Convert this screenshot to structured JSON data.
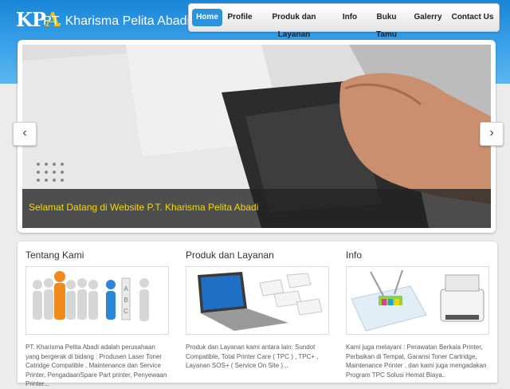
{
  "site": {
    "logo_mark": "KP",
    "logo_mark_accent": "A",
    "title": "PT. Kharisma Pelita Abadi"
  },
  "nav": {
    "items": [
      "Home",
      "Profile",
      "Produk dan Layanan",
      "Info",
      "Buku Tamu",
      "Galerry",
      "Contact Us"
    ],
    "active": "Home"
  },
  "slider": {
    "caption": "Selamat Datang di Website P.T. Kharisma Pelita Abadi",
    "prev_glyph": "‹",
    "next_glyph": "›"
  },
  "panels": [
    {
      "title": "Tentang Kami",
      "text": "PT. Kharisma Pelita Abadi adalah perusahaan yang bergerak di bidang : Produsen Laser Toner Catridge Compatible , Maintenance dan Service Printer, PengadaanSpare Part printer, Penyewaan Printer..."
    },
    {
      "title": "Produk dan Layanan",
      "text": "Produk dan Layanan kami antara lain: Sundot Compatible, Total Printer Care ( TPC ) , TPC+ , Layanan SOS+ ( Service On Site )..."
    },
    {
      "title": "Info",
      "text": "Kami juga melayani : Perawatan Berkala Printer, Perbaikan di Tempat, Garansi Toner Cartridge, Maintenance Printer , dan kami juga mengadakan Program TPC Solusi Hemat Biaya.."
    }
  ],
  "colors": {
    "header_blue": "#2b93dd",
    "caption_yellow": "#f4d800",
    "logo_accent": "#f3c400"
  }
}
